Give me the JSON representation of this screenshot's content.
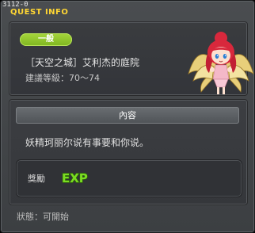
{
  "window": {
    "quest_id": "3112-0",
    "title": "QUEST INFO"
  },
  "quest": {
    "category_badge": "一般",
    "name": "［天空之城］艾利杰的庭院",
    "recommended_level": "建議等級：70～74"
  },
  "content": {
    "header": "內容",
    "description": "妖精珂丽尔说有事要和你说。"
  },
  "reward": {
    "label": "獎勵",
    "icon": "exp-icon"
  },
  "status": "狀態：可開始",
  "colors": {
    "accent_title": "#ffd633",
    "badge_green": "#8cc22a",
    "exp_green": "#7bdc22"
  }
}
